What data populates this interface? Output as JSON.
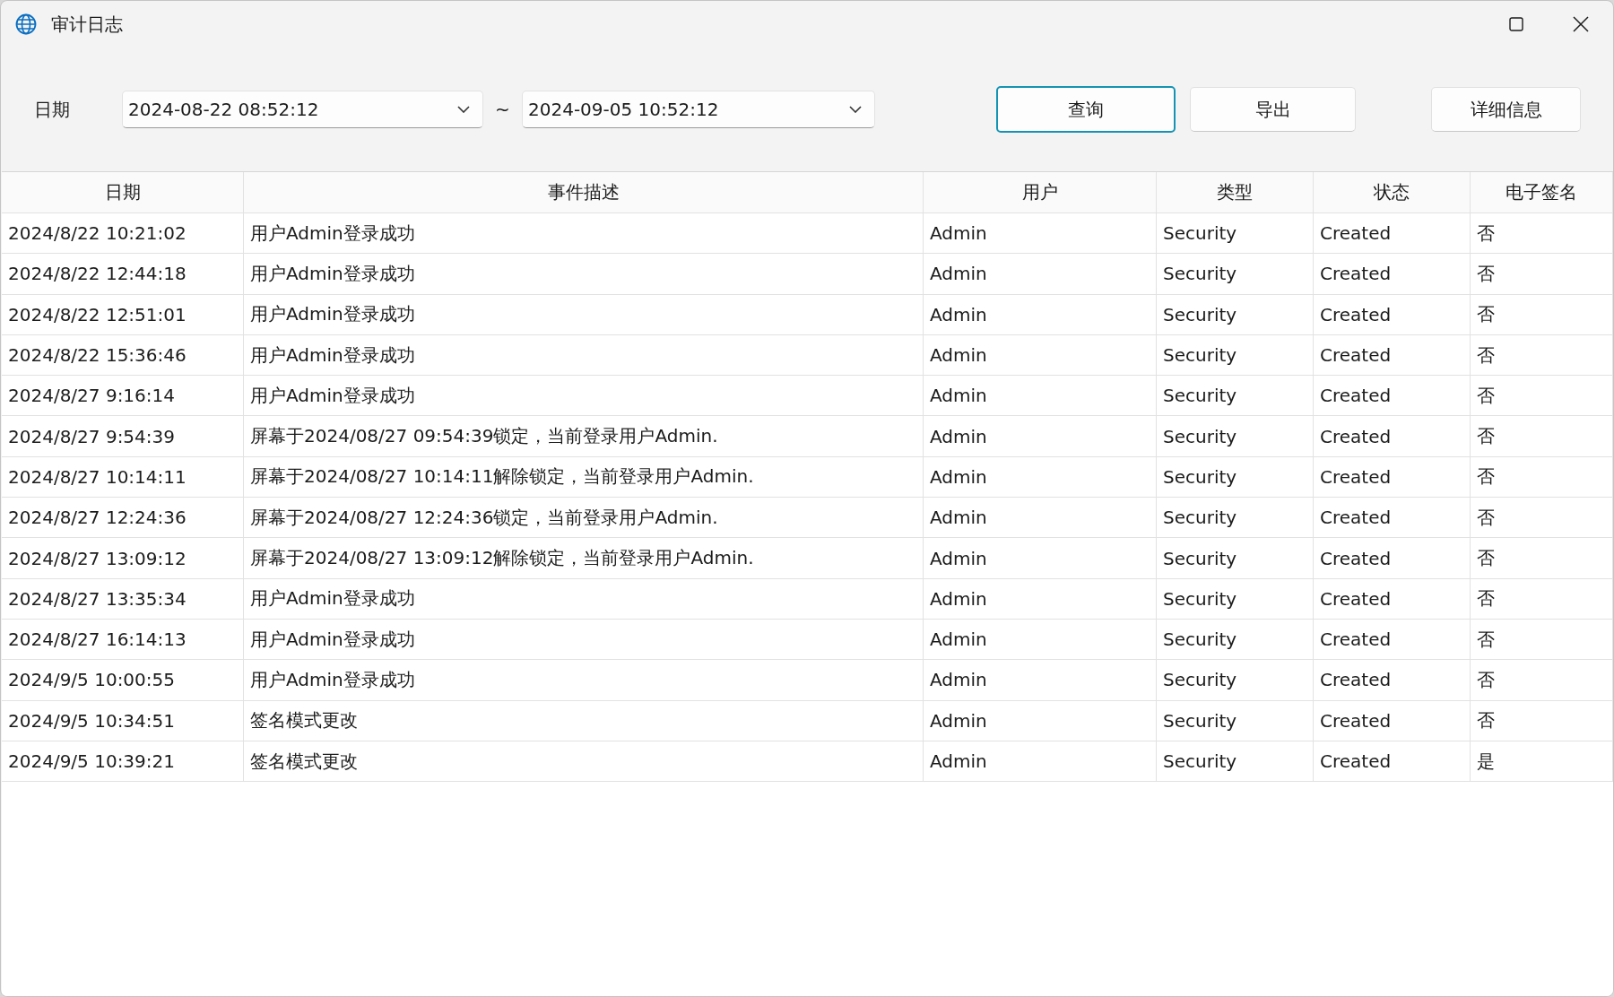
{
  "window": {
    "title": "审计日志"
  },
  "filter": {
    "label": "日期",
    "start": {
      "value": "2024-08-22 08:52:12"
    },
    "separator": "~",
    "end": {
      "value": "2024-09-05 10:52:12"
    }
  },
  "buttons": [
    {
      "label": "查询",
      "focused": true
    },
    {
      "label": "导出",
      "focused": false
    },
    {
      "label": "详细信息",
      "focused": false
    }
  ],
  "table": {
    "columns": [
      "日期",
      "事件描述",
      "用户",
      "类型",
      "状态",
      "电子签名"
    ],
    "rows": [
      [
        "2024/8/22 10:21:02",
        "用户Admin登录成功",
        "Admin",
        "Security",
        "Created",
        "否"
      ],
      [
        "2024/8/22 12:44:18",
        "用户Admin登录成功",
        "Admin",
        "Security",
        "Created",
        "否"
      ],
      [
        "2024/8/22 12:51:01",
        "用户Admin登录成功",
        "Admin",
        "Security",
        "Created",
        "否"
      ],
      [
        "2024/8/22 15:36:46",
        "用户Admin登录成功",
        "Admin",
        "Security",
        "Created",
        "否"
      ],
      [
        "2024/8/27 9:16:14",
        "用户Admin登录成功",
        "Admin",
        "Security",
        "Created",
        "否"
      ],
      [
        "2024/8/27 9:54:39",
        "屏幕于2024/08/27 09:54:39锁定，当前登录用户Admin.",
        "Admin",
        "Security",
        "Created",
        "否"
      ],
      [
        "2024/8/27 10:14:11",
        "屏幕于2024/08/27 10:14:11解除锁定，当前登录用户Admin.",
        "Admin",
        "Security",
        "Created",
        "否"
      ],
      [
        "2024/8/27 12:24:36",
        "屏幕于2024/08/27 12:24:36锁定，当前登录用户Admin.",
        "Admin",
        "Security",
        "Created",
        "否"
      ],
      [
        "2024/8/27 13:09:12",
        "屏幕于2024/08/27 13:09:12解除锁定，当前登录用户Admin.",
        "Admin",
        "Security",
        "Created",
        "否"
      ],
      [
        "2024/8/27 13:35:34",
        "用户Admin登录成功",
        "Admin",
        "Security",
        "Created",
        "否"
      ],
      [
        "2024/8/27 16:14:13",
        "用户Admin登录成功",
        "Admin",
        "Security",
        "Created",
        "否"
      ],
      [
        "2024/9/5 10:00:55",
        "用户Admin登录成功",
        "Admin",
        "Security",
        "Created",
        "否"
      ],
      [
        "2024/9/5 10:34:51",
        "签名模式更改",
        "Admin",
        "Security",
        "Created",
        "否"
      ],
      [
        "2024/9/5 10:39:21",
        "签名模式更改",
        "Admin",
        "Security",
        "Created",
        "是"
      ]
    ]
  }
}
